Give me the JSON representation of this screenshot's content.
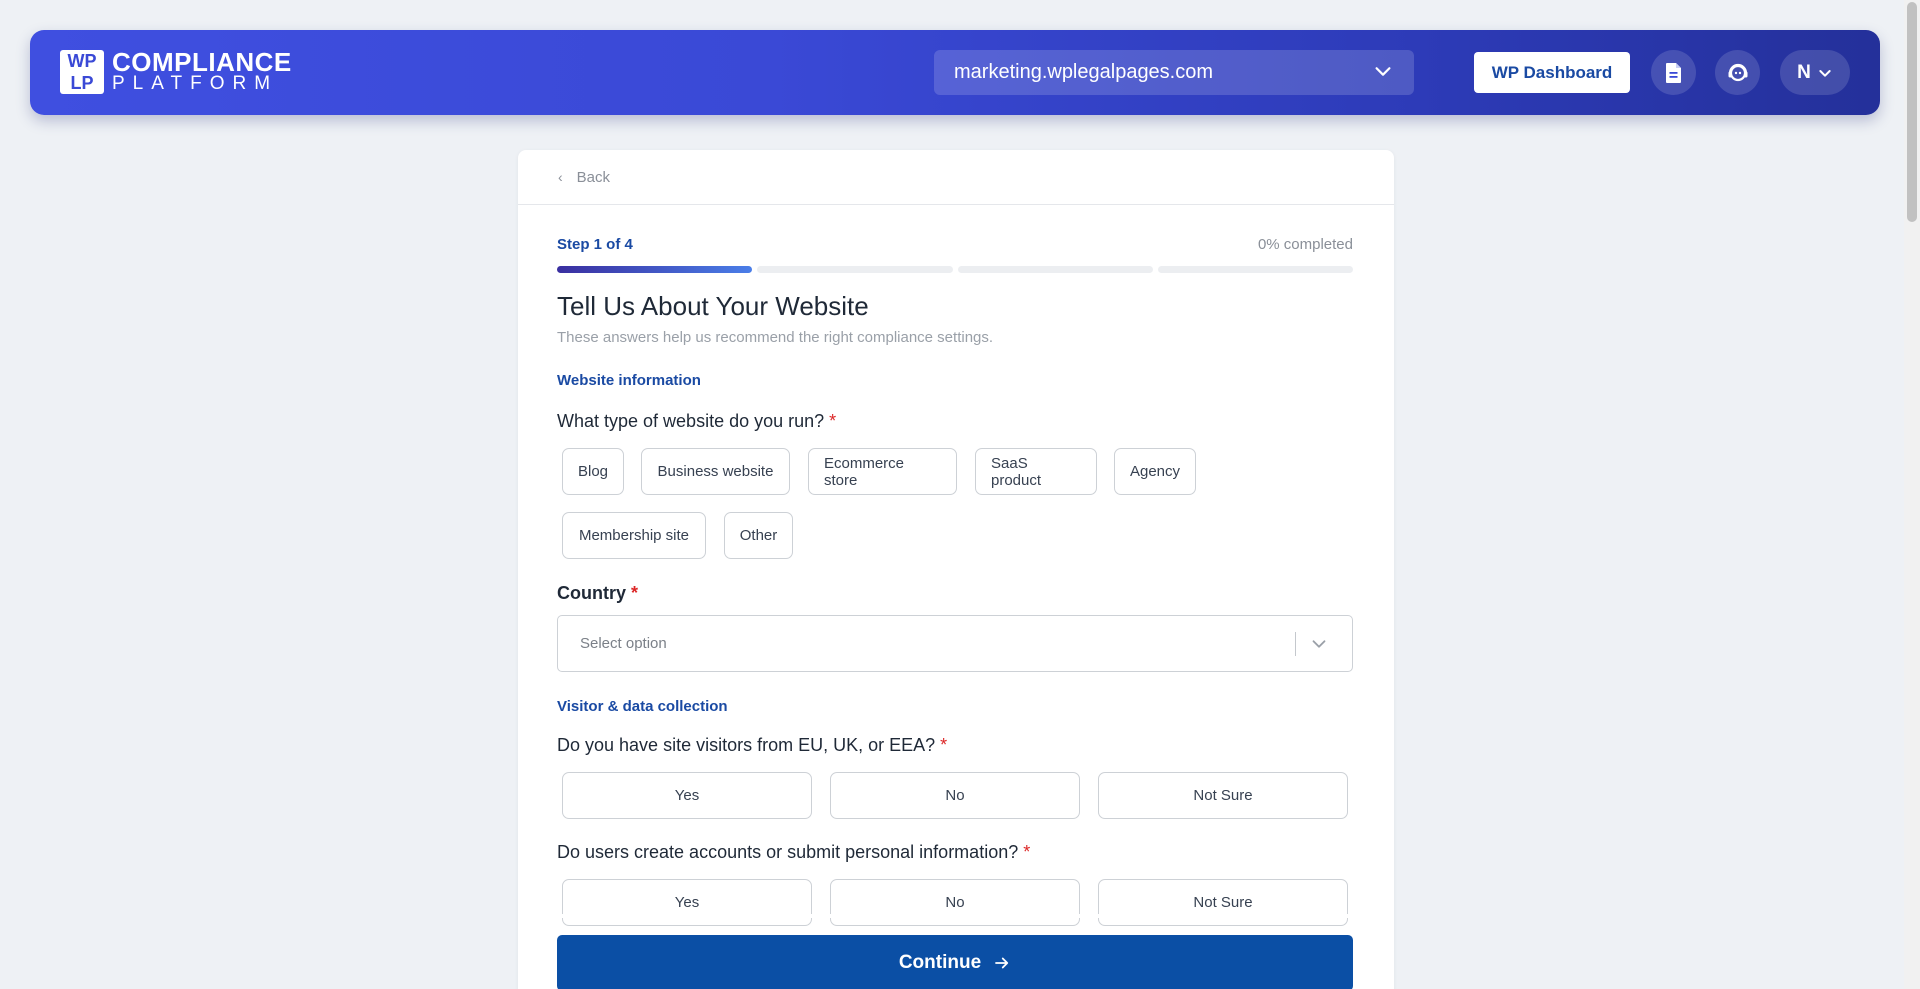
{
  "header": {
    "logo": {
      "mark": [
        "WP",
        "LP"
      ],
      "line1": "COMPLIANCE",
      "line2": "PLATFORM"
    },
    "site_select": {
      "value": "marketing.wplegalpages.com",
      "icon": "chevron-down-icon"
    },
    "wp_dashboard_label": "WP Dashboard",
    "document_icon": "document-icon",
    "support_icon": "support-icon",
    "user_initial": "N"
  },
  "card": {
    "back_label": "Back",
    "step_label": "Step 1 of 4",
    "completed_label": "0% completed",
    "progress": {
      "current_step": 1,
      "total_steps": 4,
      "percent_complete": 0
    },
    "title": "Tell Us About Your Website",
    "subtitle": "These answers help us recommend the right compliance settings.",
    "section_website": "Website information",
    "q_website_type": "What type of website do you run?",
    "website_types": [
      "Blog",
      "Business website",
      "Ecommerce store",
      "SaaS product",
      "Agency",
      "Membership site",
      "Other"
    ],
    "q_country": "Country",
    "country_placeholder": "Select option",
    "section_visitor": "Visitor & data collection",
    "q_visitors": "Do you have site visitors from EU, UK, or EEA?",
    "visitor_options": [
      "Yes",
      "No",
      "Not Sure"
    ],
    "q_accounts": "Do users create accounts or submit personal information?",
    "account_options": [
      "Yes",
      "No",
      "Not Sure"
    ],
    "required_mark": "*",
    "continue_label": "Continue"
  },
  "colors": {
    "brand_blue": "#0b4fa5",
    "header_gradient_start": "#3f4fe0",
    "header_gradient_end": "#24309a",
    "required": "#dc2626",
    "section_label": "#1a4aa3"
  }
}
